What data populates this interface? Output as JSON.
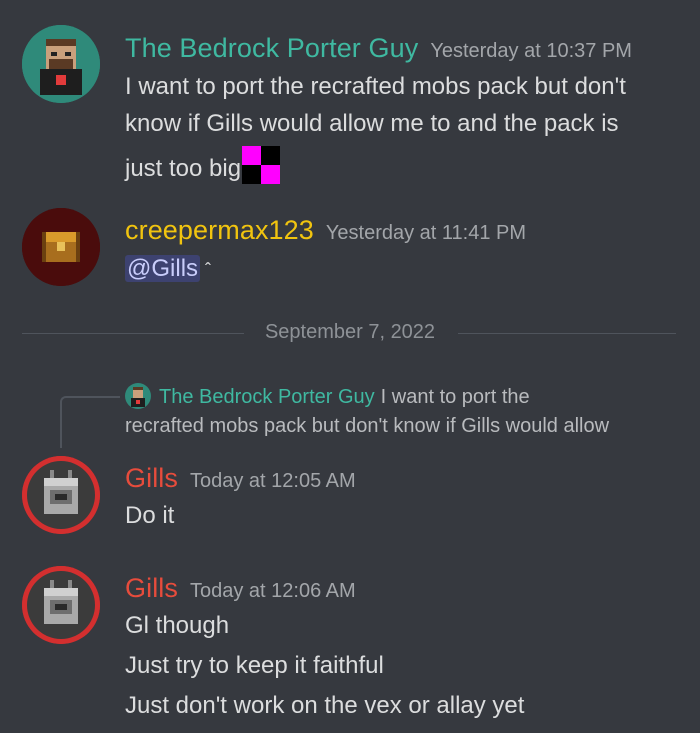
{
  "colors": {
    "background": "#36393f",
    "bedrock_name": "#3fb9a1",
    "creeper_name": "#f1c40f",
    "gills_name": "#e74c3c"
  },
  "messages": [
    {
      "author": "The Bedrock Porter Guy",
      "timestamp": "Yesterday at 10:37 PM",
      "lines": [
        "I want to port the recrafted mobs pack but don't",
        "know if Gills would allow me to and the pack is",
        "just too big"
      ]
    },
    {
      "author": "creepermax123",
      "timestamp": "Yesterday at 11:41 PM",
      "mention": "@Gills",
      "suffix": " ˆ"
    },
    {
      "author": "Gills",
      "timestamp": "Today at 12:05 AM",
      "lines": [
        "Do it"
      ],
      "reply": {
        "author": "The Bedrock Porter Guy",
        "text_line1": "I want to port the",
        "text_line2": "recrafted mobs pack but don't know if Gills would allow"
      }
    },
    {
      "author": "Gills",
      "timestamp": "Today at 12:06 AM",
      "lines": [
        "Gl though",
        "Just try to keep it faithful",
        "Just don't work on the vex or allay yet"
      ]
    }
  ],
  "divider": {
    "date": "September 7, 2022"
  }
}
